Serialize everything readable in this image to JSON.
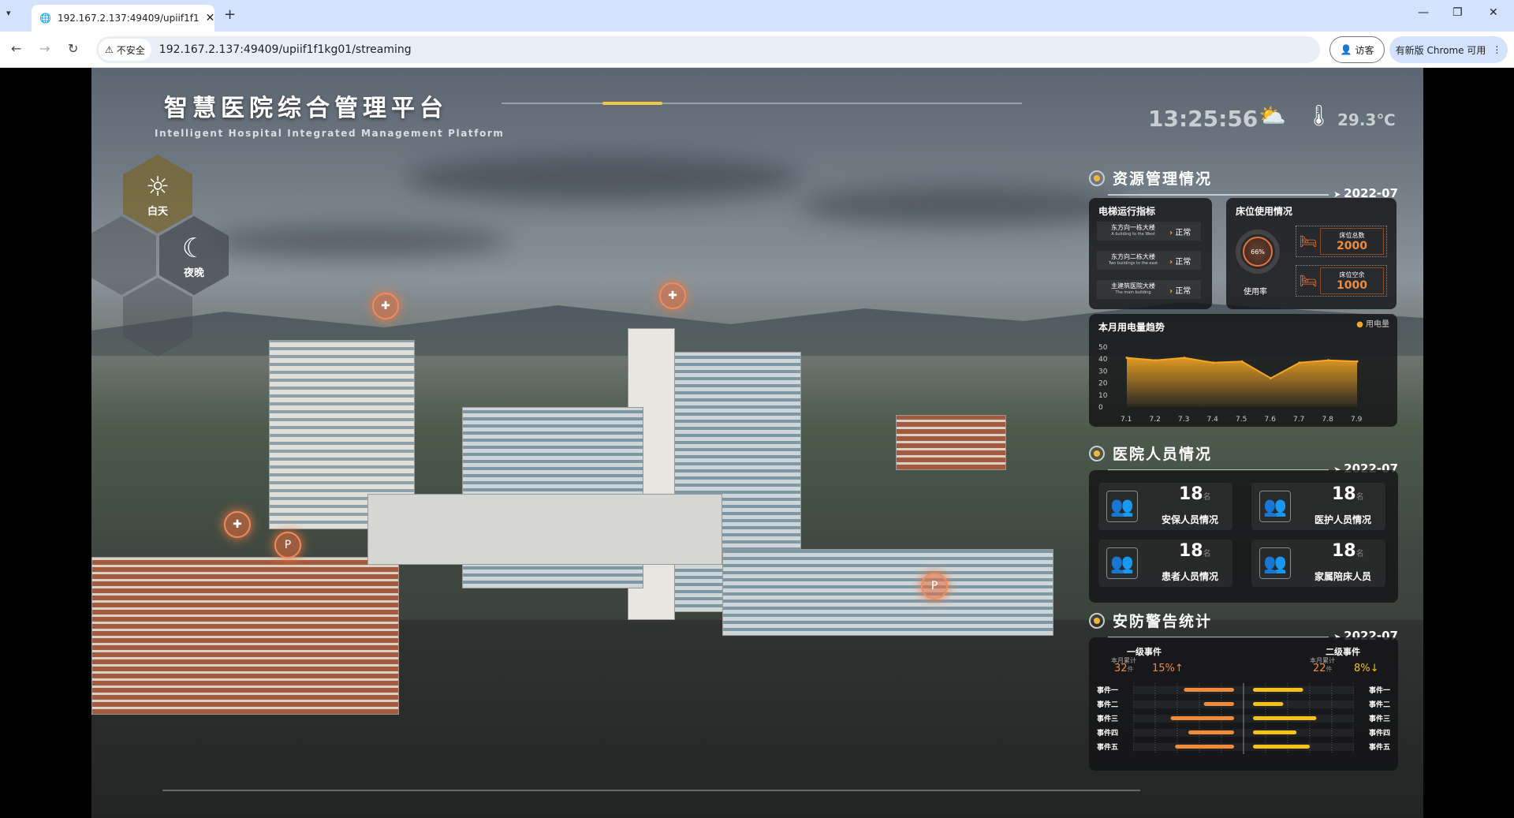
{
  "browser": {
    "tab_title": "192.167.2.137:49409/upiif1f1",
    "url": "192.167.2.137:49409/upiif1f1kg01/streaming",
    "insecure_label": "不安全",
    "guest_label": "访客",
    "update_label": "有新版 Chrome 可用"
  },
  "header": {
    "title": "智慧医院综合管理平台",
    "subtitle": "Intelligent Hospital Integrated Management Platform",
    "time": "13:25:56",
    "temperature": "29.3℃",
    "weather_icon": "partly-sunny-icon"
  },
  "mode": {
    "day": "白天",
    "night": "夜晚",
    "active": "白天"
  },
  "resource": {
    "title": "资源管理情况",
    "date": "2022-07",
    "elevator": {
      "title": "电梯运行指标",
      "items": [
        {
          "name": "东方向一栋大楼",
          "en": "A building to the West",
          "status": "正常"
        },
        {
          "name": "东方向二栋大楼",
          "en": "Two buildings to the east",
          "status": "正常"
        },
        {
          "name": "主建筑医院大楼",
          "en": "The main building",
          "status": "正常"
        }
      ]
    },
    "beds": {
      "title": "床位使用情况",
      "usage_rate": "66%",
      "usage_label": "使用率",
      "total_label": "床位总数",
      "total": "2000",
      "free_label": "床位空余",
      "free": "1000"
    }
  },
  "chart_data": {
    "type": "area",
    "title": "本月用电量趋势",
    "legend": [
      "用电量"
    ],
    "legend_position": "top-right",
    "categories": [
      "7.1",
      "7.2",
      "7.3",
      "7.4",
      "7.5",
      "7.6",
      "7.7",
      "7.8",
      "7.9"
    ],
    "series": [
      {
        "name": "用电量",
        "values": [
          41,
          39,
          41,
          37,
          38,
          24,
          37,
          39,
          38
        ]
      }
    ],
    "yticks": [
      "0",
      "10",
      "20",
      "30",
      "40",
      "50"
    ],
    "ylim": [
      0,
      50
    ],
    "color": "#f5a623"
  },
  "staff": {
    "title": "医院人员情况",
    "date": "2022-07",
    "unit": "名",
    "items": [
      {
        "label": "安保人员情况",
        "count": "18"
      },
      {
        "label": "医护人员情况",
        "count": "18"
      },
      {
        "label": "患者人员情况",
        "count": "18"
      },
      {
        "label": "家属陪床人员",
        "count": "18"
      }
    ]
  },
  "security": {
    "title": "安防警告统计",
    "date": "2022-07",
    "level1": {
      "title": "一级事件",
      "sub": "本月累计",
      "count": "32",
      "unit": "件",
      "change": "15%↑",
      "color": "#f08b3c"
    },
    "level2": {
      "title": "二级事件",
      "sub": "本月累计",
      "count": "22",
      "unit": "件",
      "change": "8%↓",
      "color": "#f5c218"
    },
    "events": [
      "事件一",
      "事件二",
      "事件三",
      "事件四",
      "事件五"
    ],
    "level1_values": [
      27,
      18,
      33,
      25,
      31
    ],
    "level2_values": [
      27,
      18,
      33,
      24,
      30
    ]
  }
}
